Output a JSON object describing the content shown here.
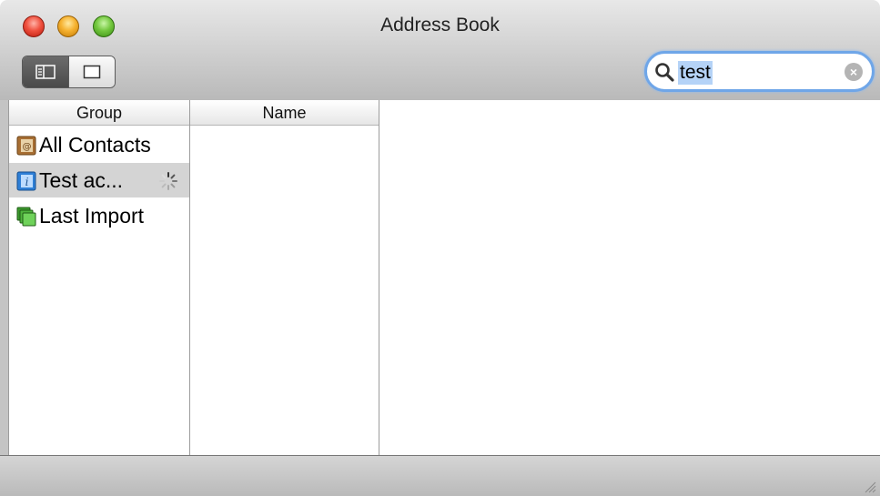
{
  "window": {
    "title": "Address Book"
  },
  "toolbar": {
    "search": {
      "query": "test"
    }
  },
  "columns": {
    "group": "Group",
    "name": "Name"
  },
  "groups": [
    {
      "label": "All Contacts",
      "icon": "address-book-icon",
      "selected": false
    },
    {
      "label": "Test ac...",
      "icon": "info-card-icon",
      "selected": true,
      "loading": true
    },
    {
      "label": "Last Import",
      "icon": "import-stack-icon",
      "selected": false
    }
  ],
  "colors": {
    "close": "#f0513f",
    "minimize": "#f6b230",
    "zoom": "#74c83f",
    "search_focus": "#6fa6e8",
    "selection": "#d4d4d4"
  }
}
